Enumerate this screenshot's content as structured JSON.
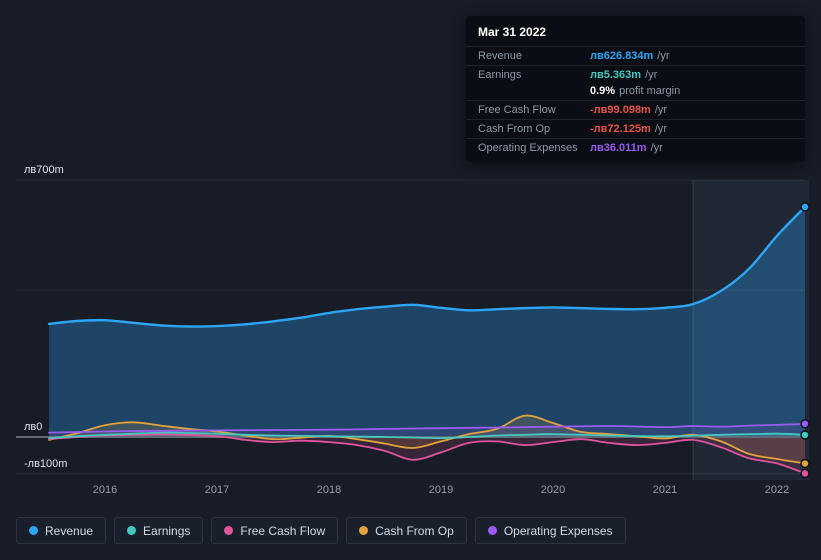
{
  "tooltip": {
    "date": "Mar 31 2022",
    "rows": [
      {
        "label": "Revenue",
        "value": "лв626.834m",
        "suffix": "/yr",
        "color": "#2ea6f7"
      },
      {
        "label": "Earnings",
        "value": "лв5.363m",
        "suffix": "/yr",
        "color": "#45c8bd"
      },
      {
        "label": "",
        "value": "0.9%",
        "suffix": "profit margin",
        "color": "#ffffff"
      },
      {
        "label": "Free Cash Flow",
        "value": "-лв99.098m",
        "suffix": "/yr",
        "color": "#e8544b"
      },
      {
        "label": "Cash From Op",
        "value": "-лв72.125m",
        "suffix": "/yr",
        "color": "#e8544b"
      },
      {
        "label": "Operating Expenses",
        "value": "лв36.011m",
        "suffix": "/yr",
        "color": "#9a5cf0"
      }
    ]
  },
  "y_axis": {
    "labels": [
      {
        "text": "лв700m",
        "value": 700
      },
      {
        "text": "лв0",
        "value": 0
      },
      {
        "text": "-лв100m",
        "value": -100
      }
    ]
  },
  "x_axis": {
    "labels": [
      {
        "text": "2016",
        "value": 2016
      },
      {
        "text": "2017",
        "value": 2017
      },
      {
        "text": "2018",
        "value": 2018
      },
      {
        "text": "2019",
        "value": 2019
      },
      {
        "text": "2020",
        "value": 2020
      },
      {
        "text": "2021",
        "value": 2021
      },
      {
        "text": "2022",
        "value": 2022
      }
    ]
  },
  "legend": {
    "items": [
      {
        "label": "Revenue",
        "color": "#2ea6f7"
      },
      {
        "label": "Earnings",
        "color": "#45c8bd"
      },
      {
        "label": "Free Cash Flow",
        "color": "#e0549b"
      },
      {
        "label": "Cash From Op",
        "color": "#e2a33d"
      },
      {
        "label": "Operating Expenses",
        "color": "#9a5cf0"
      }
    ]
  },
  "chart_data": {
    "type": "line",
    "title": "Earnings and Revenue History",
    "currency": "лв",
    "unit": "millions",
    "ylim": [
      -100,
      700
    ],
    "xlim": [
      2015.45,
      2022.35
    ],
    "grid": true,
    "legend_position": "bottom",
    "gridline_values": [
      700,
      400,
      0,
      -100
    ],
    "highlight_region": {
      "start": 2021.25,
      "end": 2022.35
    },
    "series": [
      {
        "name": "Revenue",
        "color": "#2ea6f7",
        "points": [
          [
            2015.5,
            308
          ],
          [
            2015.75,
            316
          ],
          [
            2016,
            318
          ],
          [
            2016.25,
            311
          ],
          [
            2016.5,
            304
          ],
          [
            2016.75,
            301
          ],
          [
            2017,
            302
          ],
          [
            2017.25,
            307
          ],
          [
            2017.5,
            315
          ],
          [
            2017.75,
            325
          ],
          [
            2018,
            338
          ],
          [
            2018.25,
            348
          ],
          [
            2018.5,
            355
          ],
          [
            2018.75,
            360
          ],
          [
            2019,
            352
          ],
          [
            2019.25,
            345
          ],
          [
            2019.5,
            348
          ],
          [
            2019.75,
            351
          ],
          [
            2020,
            353
          ],
          [
            2020.25,
            351
          ],
          [
            2020.5,
            349
          ],
          [
            2020.75,
            348
          ],
          [
            2021,
            352
          ],
          [
            2021.25,
            362
          ],
          [
            2021.5,
            398
          ],
          [
            2021.75,
            458
          ],
          [
            2022,
            548
          ],
          [
            2022.25,
            626.834
          ]
        ]
      },
      {
        "name": "Cash From Op",
        "color": "#e2a33d",
        "points": [
          [
            2015.5,
            -8
          ],
          [
            2015.75,
            10
          ],
          [
            2016,
            32
          ],
          [
            2016.25,
            40
          ],
          [
            2016.5,
            31
          ],
          [
            2016.75,
            22
          ],
          [
            2017,
            15
          ],
          [
            2017.25,
            4
          ],
          [
            2017.5,
            -6
          ],
          [
            2017.75,
            -2
          ],
          [
            2018,
            3
          ],
          [
            2018.25,
            -6
          ],
          [
            2018.5,
            -18
          ],
          [
            2018.75,
            -30
          ],
          [
            2019,
            -12
          ],
          [
            2019.25,
            8
          ],
          [
            2019.5,
            22
          ],
          [
            2019.75,
            58
          ],
          [
            2020,
            38
          ],
          [
            2020.25,
            14
          ],
          [
            2020.5,
            8
          ],
          [
            2020.75,
            2
          ],
          [
            2021,
            -4
          ],
          [
            2021.25,
            6
          ],
          [
            2021.5,
            -12
          ],
          [
            2021.75,
            -46
          ],
          [
            2022,
            -60
          ],
          [
            2022.25,
            -72.125
          ]
        ]
      },
      {
        "name": "Free Cash Flow",
        "color": "#e0549b",
        "points": [
          [
            2015.5,
            -6
          ],
          [
            2015.75,
            0
          ],
          [
            2016,
            4
          ],
          [
            2016.5,
            7
          ],
          [
            2017,
            2
          ],
          [
            2017.25,
            -8
          ],
          [
            2017.5,
            -14
          ],
          [
            2017.75,
            -10
          ],
          [
            2018,
            -14
          ],
          [
            2018.25,
            -22
          ],
          [
            2018.5,
            -38
          ],
          [
            2018.75,
            -62
          ],
          [
            2019,
            -42
          ],
          [
            2019.25,
            -16
          ],
          [
            2019.5,
            -12
          ],
          [
            2019.75,
            -22
          ],
          [
            2020,
            -14
          ],
          [
            2020.25,
            -6
          ],
          [
            2020.5,
            -16
          ],
          [
            2020.75,
            -22
          ],
          [
            2021,
            -16
          ],
          [
            2021.25,
            -8
          ],
          [
            2021.5,
            -28
          ],
          [
            2021.75,
            -58
          ],
          [
            2022,
            -72
          ],
          [
            2022.25,
            -99.098
          ]
        ]
      },
      {
        "name": "Earnings",
        "color": "#45c8bd",
        "points": [
          [
            2015.5,
            -3
          ],
          [
            2015.75,
            2
          ],
          [
            2016,
            6
          ],
          [
            2016.25,
            9
          ],
          [
            2016.5,
            12
          ],
          [
            2016.75,
            11
          ],
          [
            2017,
            9
          ],
          [
            2017.25,
            6
          ],
          [
            2017.5,
            4
          ],
          [
            2018,
            2
          ],
          [
            2018.5,
            0
          ],
          [
            2019,
            -3
          ],
          [
            2019.25,
            0
          ],
          [
            2019.5,
            4
          ],
          [
            2019.75,
            6
          ],
          [
            2020,
            8
          ],
          [
            2020.5,
            4
          ],
          [
            2021,
            2
          ],
          [
            2021.5,
            6
          ],
          [
            2022,
            9
          ],
          [
            2022.25,
            5.363
          ]
        ]
      },
      {
        "name": "Operating Expenses",
        "color": "#9a5cf0",
        "points": [
          [
            2015.5,
            12
          ],
          [
            2016,
            15
          ],
          [
            2016.5,
            17
          ],
          [
            2017,
            18
          ],
          [
            2017.5,
            19
          ],
          [
            2018,
            20
          ],
          [
            2018.5,
            22
          ],
          [
            2019,
            24
          ],
          [
            2019.5,
            26
          ],
          [
            2020,
            28
          ],
          [
            2020.5,
            30
          ],
          [
            2021,
            27
          ],
          [
            2021.25,
            30
          ],
          [
            2021.5,
            28
          ],
          [
            2021.75,
            31
          ],
          [
            2022,
            33
          ],
          [
            2022.25,
            36.011
          ]
        ]
      }
    ]
  }
}
